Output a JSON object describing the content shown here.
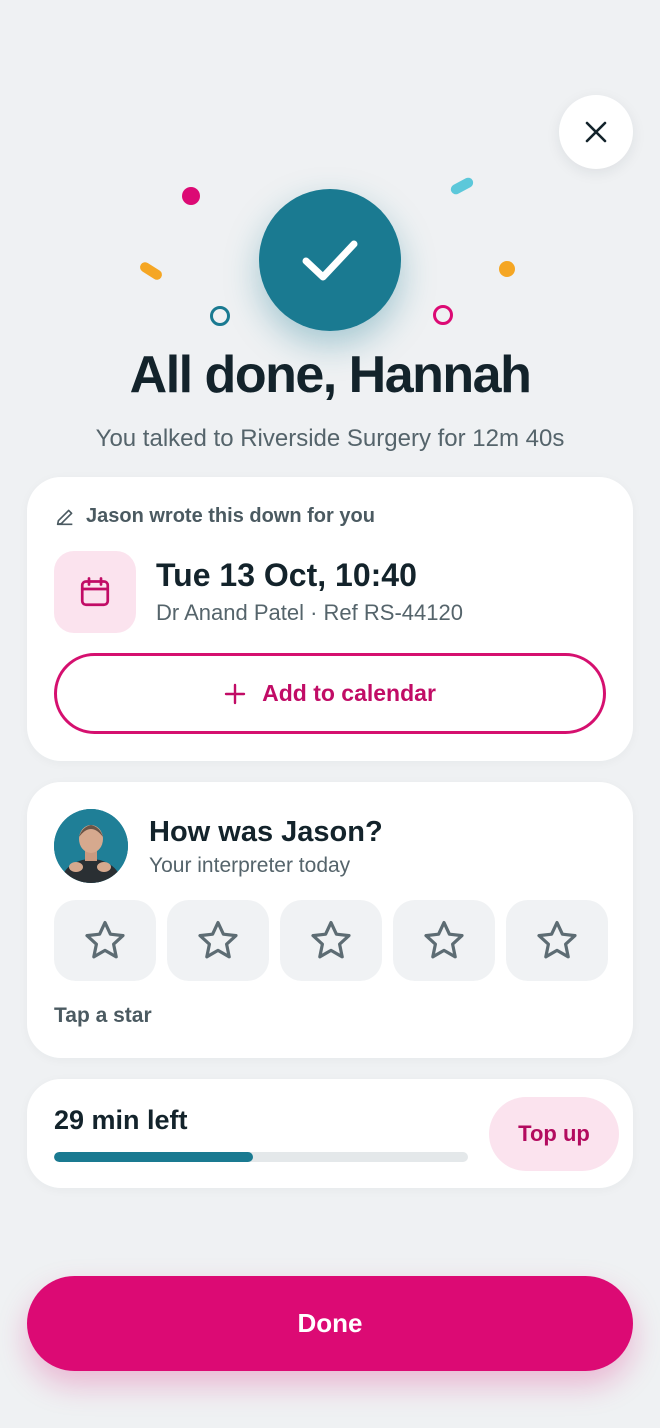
{
  "header": {
    "close_icon": "close-icon",
    "title": "All done, Hannah",
    "subtitle": "You talked to Riverside Surgery for 12m 40s"
  },
  "appointment": {
    "note_icon": "pencil-icon",
    "note": "Jason wrote this down for you",
    "calendar_icon": "calendar-icon",
    "date": "Tue 13 Oct, 10:40",
    "meta": "Dr Anand Patel · Ref RS-44120",
    "add_icon": "plus-icon",
    "add_label": "Add to calendar"
  },
  "rating": {
    "title": "How was Jason?",
    "subtitle": "Your interpreter today",
    "stars_total": 5,
    "stars_selected": 0,
    "hint": "Tap a star"
  },
  "time": {
    "label": "29 min left",
    "progress_fraction": 0.48,
    "topup_label": "Top up"
  },
  "done_label": "Done",
  "colors": {
    "accent_pink": "#dc0a74",
    "teal": "#1a7a91",
    "background": "#eff1f3"
  }
}
